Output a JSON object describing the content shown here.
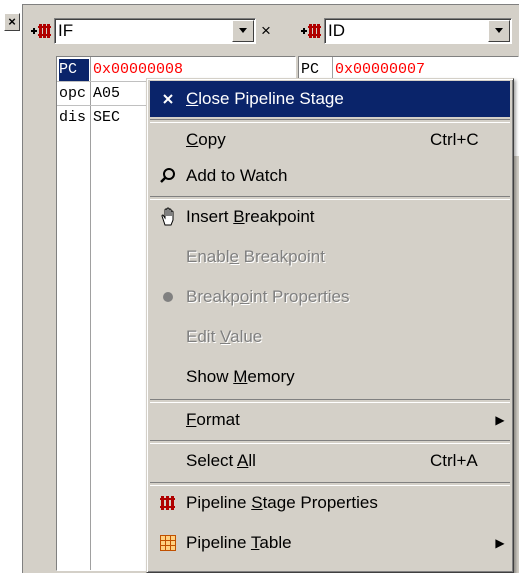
{
  "gutter": {
    "close_glyph": "×"
  },
  "stage_if": {
    "name": "IF",
    "rows": [
      {
        "name": "PC",
        "value": "0x00000008"
      },
      {
        "name": "opc",
        "value": "A05"
      },
      {
        "name": "dis",
        "value": "SEC"
      }
    ]
  },
  "stage_id": {
    "name": "ID",
    "rows": [
      {
        "name": "PC",
        "value": "0x00000007"
      }
    ]
  },
  "close_glyph": "×",
  "menu": {
    "items": [
      {
        "label": "Close Pipeline Stage",
        "mnemonic": "C",
        "icon": "close-icon",
        "highlighted": true,
        "enabled": true
      },
      {
        "label": "Copy",
        "mnemonic": "C",
        "shortcut": "Ctrl+C",
        "enabled": true
      },
      {
        "label": "Add to Watch",
        "icon": "magnifier-icon",
        "enabled": true
      },
      {
        "label": "Insert Breakpoint",
        "mnemonic": "B",
        "icon": "hand-icon",
        "enabled": true
      },
      {
        "label": "Enable Breakpoint",
        "mnemonic": "e",
        "enabled": false
      },
      {
        "label": "Breakpoint Properties",
        "mnemonic": "o",
        "icon": "breakpoint-dot-icon",
        "enabled": false
      },
      {
        "label": "Edit Value",
        "mnemonic": "V",
        "enabled": false
      },
      {
        "label": "Show Memory",
        "mnemonic": "M",
        "enabled": true
      },
      {
        "label": "Format",
        "mnemonic": "F",
        "submenu": true,
        "enabled": true
      },
      {
        "label": "Select All",
        "mnemonic": "A",
        "shortcut": "Ctrl+A",
        "enabled": true
      },
      {
        "label": "Pipeline Stage Properties",
        "mnemonic": "S",
        "icon": "pipeline-icon",
        "enabled": true
      },
      {
        "label": "Pipeline Table",
        "mnemonic": "T",
        "icon": "table-grid-icon",
        "submenu": true,
        "enabled": true
      }
    ]
  },
  "colors": {
    "highlight": "#0a246a",
    "face": "#d4d0c8",
    "value_red": "#ff0000",
    "disabled": "#808080"
  }
}
